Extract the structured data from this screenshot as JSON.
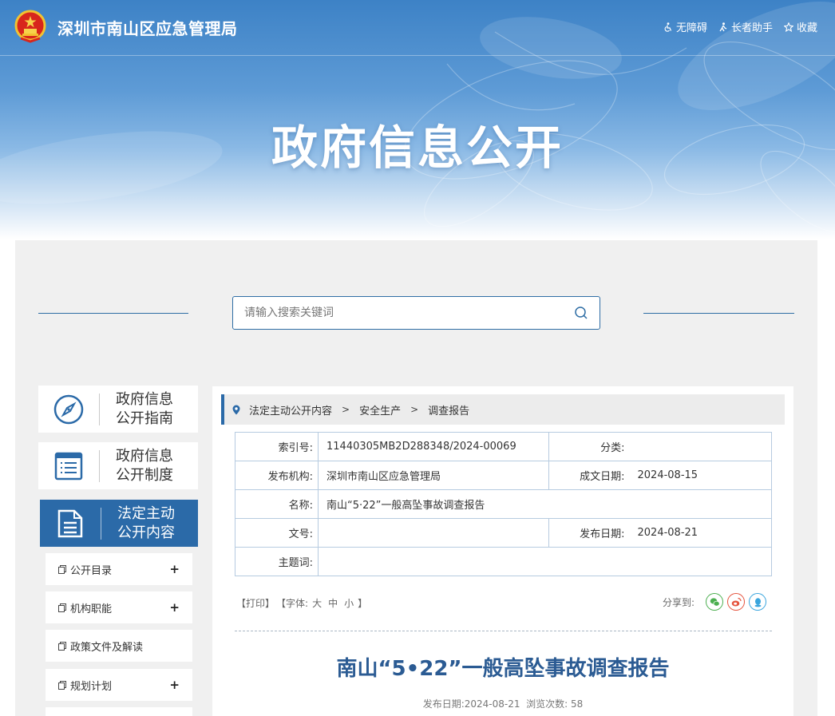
{
  "header": {
    "site_name": "深圳市南山区应急管理局",
    "banner_title": "政府信息公开",
    "top_links": [
      {
        "label": "无障碍",
        "icon": "accessibility-icon"
      },
      {
        "label": "长者助手",
        "icon": "elderly-helper-icon"
      },
      {
        "label": "收藏",
        "icon": "star-icon"
      }
    ]
  },
  "search": {
    "placeholder": "请输入搜索关键词"
  },
  "sidebar": {
    "cards": [
      {
        "line1": "政府信息",
        "line2": "公开指南",
        "icon": "compass-icon",
        "active": false
      },
      {
        "line1": "政府信息",
        "line2": "公开制度",
        "icon": "list-document-icon",
        "active": false
      },
      {
        "line1": "法定主动",
        "line2": "公开内容",
        "icon": "document-icon",
        "active": true
      }
    ],
    "sub_items": [
      {
        "label": "公开目录",
        "expandable": true,
        "plus": "+"
      },
      {
        "label": "机构职能",
        "expandable": true,
        "plus": "+"
      },
      {
        "label": "政策文件及解读",
        "expandable": false,
        "plus": ""
      },
      {
        "label": "规划计划",
        "expandable": true,
        "plus": "+"
      }
    ]
  },
  "breadcrumb": [
    "法定主动公开内容",
    "安全生产",
    "调查报告"
  ],
  "breadcrumb_sep": ">",
  "meta": {
    "index_label": "索引号:",
    "index_value": "11440305MB2D288348/2024-00069",
    "category_label": "分类:",
    "category_value": "",
    "publisher_label": "发布机构:",
    "publisher_value": "深圳市南山区应急管理局",
    "created_label": "成文日期:",
    "created_value": "2024-08-15",
    "name_label": "名称:",
    "name_value": "南山“5·22”一般高坠事故调查报告",
    "docno_label": "文号:",
    "docno_value": "",
    "pubdate_label": "发布日期:",
    "pubdate_value": "2024-08-21",
    "subject_label": "主题词:",
    "subject_value": ""
  },
  "tools": {
    "print": "【打印】",
    "font_label": "【字体:",
    "font_large": "大",
    "font_medium": "中",
    "font_small": "小",
    "font_close": "】",
    "share_label": "分享到:"
  },
  "article": {
    "title": "南山“5•22”一般高坠事故调查报告",
    "date_label": "发布日期:",
    "date_value": "2024-08-21",
    "views_label": "浏览次数:",
    "views_value": "58"
  },
  "colors": {
    "brand_blue": "#2b6aa8",
    "title_blue": "#2b5b93",
    "wechat_green": "#4caf50",
    "weibo_red": "#e5533d",
    "qq_blue": "#3aa5dd"
  }
}
